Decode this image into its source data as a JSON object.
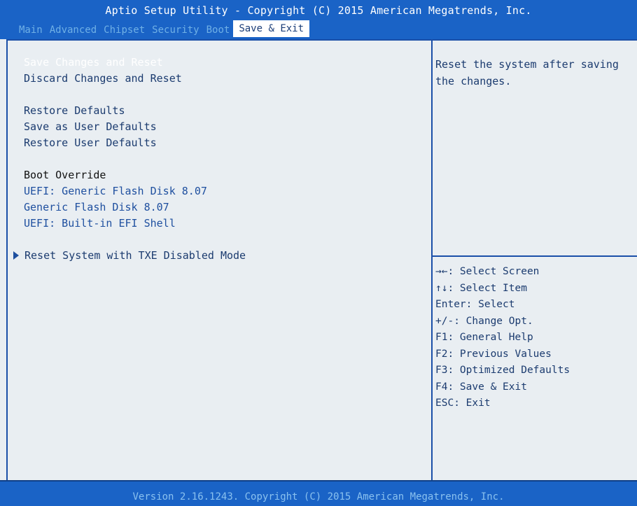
{
  "header": {
    "title": "Aptio Setup Utility - Copyright (C) 2015 American Megatrends, Inc.",
    "tabs": [
      {
        "label": "Main"
      },
      {
        "label": "Advanced"
      },
      {
        "label": "Chipset"
      },
      {
        "label": "Security"
      },
      {
        "label": "Boot"
      },
      {
        "label": "Save & Exit",
        "active": true
      }
    ]
  },
  "menu": {
    "save_changes_reset": "Save Changes and Reset",
    "discard_changes_reset": "Discard Changes and Reset",
    "restore_defaults": "Restore Defaults",
    "save_user_defaults": "Save as User Defaults",
    "restore_user_defaults": "Restore User Defaults",
    "boot_override": "Boot Override",
    "boot_items": [
      "UEFI: Generic Flash Disk 8.07",
      "Generic Flash Disk 8.07",
      "UEFI: Built-in EFI Shell"
    ],
    "reset_txe": "Reset System with TXE Disabled Mode"
  },
  "help": {
    "description": "Reset the system after saving the changes."
  },
  "keys": [
    "→←: Select Screen",
    "↑↓: Select Item",
    "Enter: Select",
    "+/-: Change Opt.",
    "F1: General Help",
    "F2: Previous Values",
    "F3: Optimized Defaults",
    "F4: Save & Exit",
    "ESC: Exit"
  ],
  "footer": {
    "text": "Version 2.16.1243. Copyright (C) 2015 American Megatrends, Inc."
  },
  "colors": {
    "header_bg": "#1a63c6",
    "panel_bg": "#e9eef2",
    "text": "#1b3b6f",
    "selected_text": "#ffffff"
  }
}
